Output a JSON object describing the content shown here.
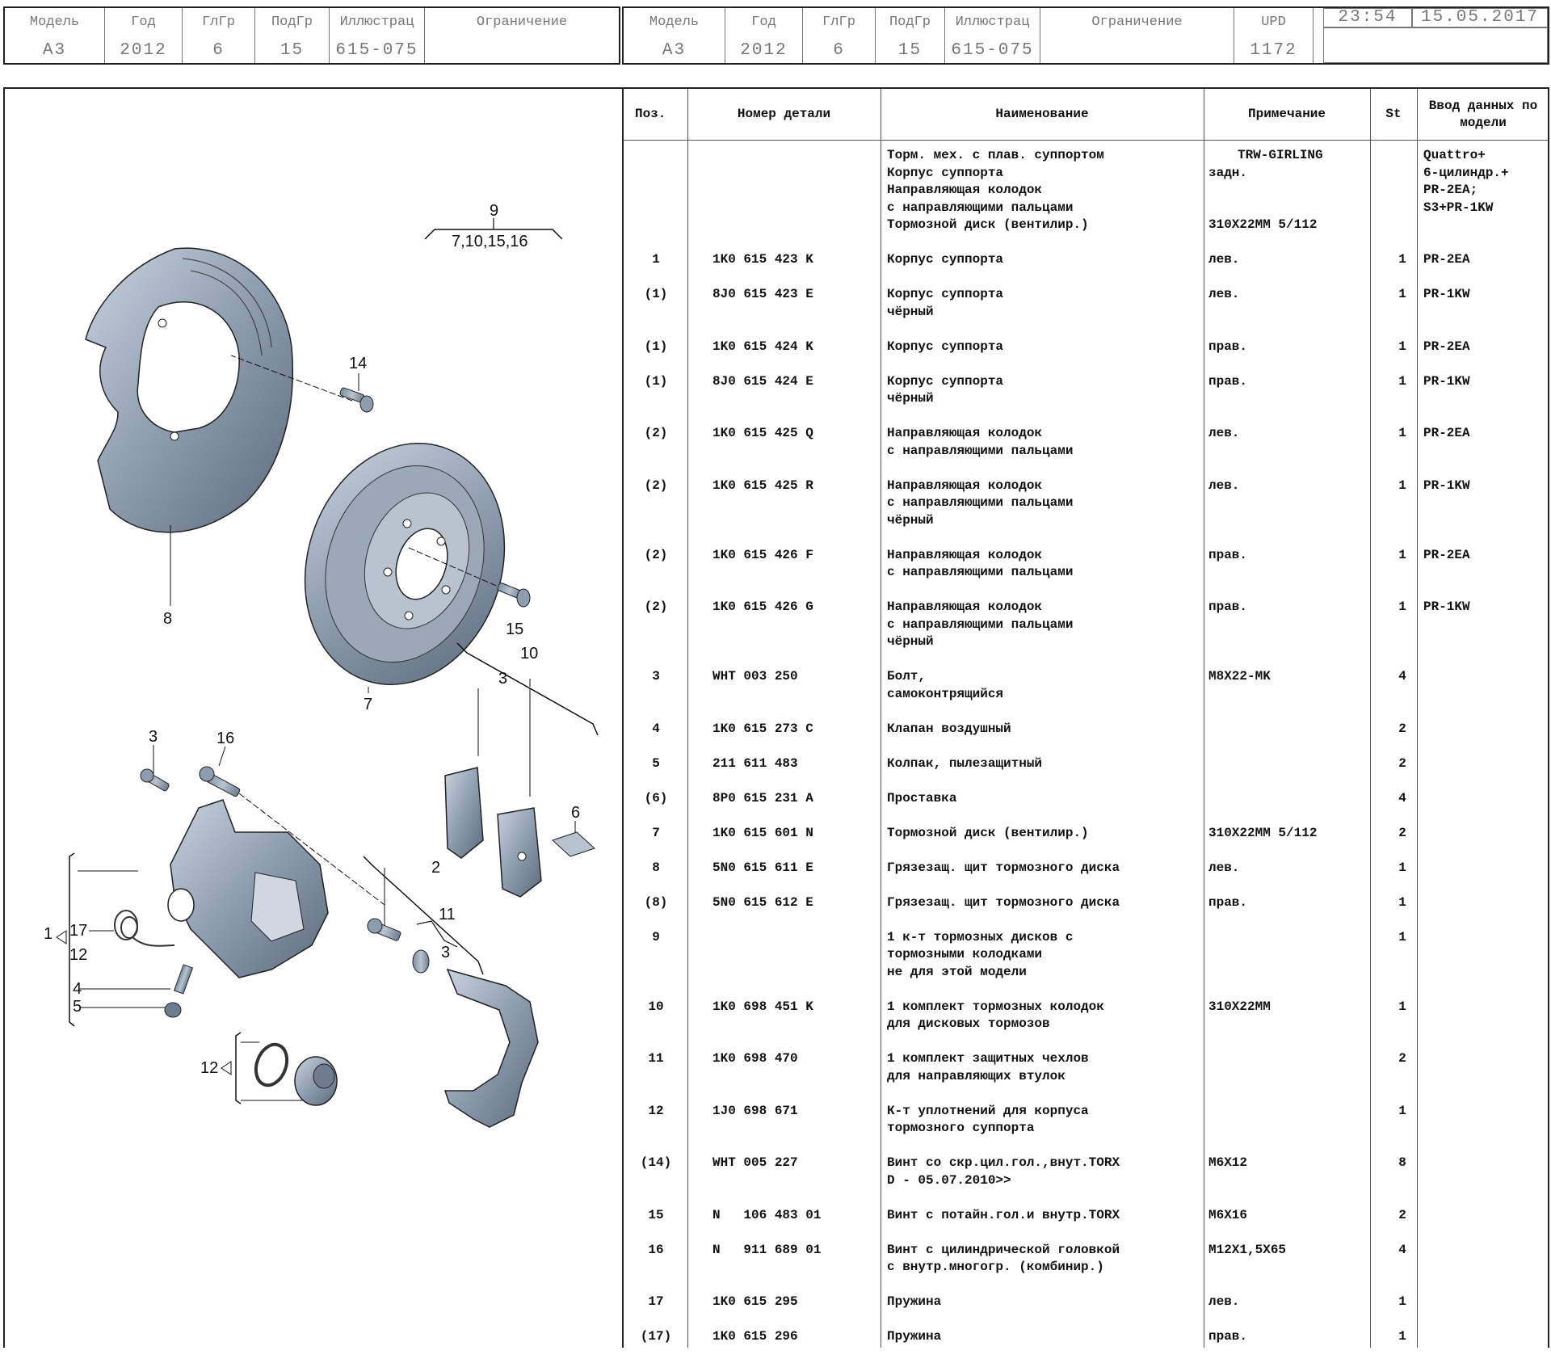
{
  "header_left": {
    "labels": [
      "Модель",
      "Год",
      "ГлГр",
      "ПодГр",
      "Иллюстрац",
      "Ограничение"
    ],
    "values": [
      "A3",
      "2012",
      "6",
      "15",
      "615-075",
      ""
    ]
  },
  "header_right": {
    "labels": [
      "Модель",
      "Год",
      "ГлГр",
      "ПодГр",
      "Иллюстрац",
      "Ограничение",
      "UPD"
    ],
    "values": [
      "A3",
      "2012",
      "6",
      "15",
      "615-075",
      "",
      "1172"
    ],
    "time": "23:54",
    "date": "15.05.2017"
  },
  "table_headers": {
    "pos": "Поз.",
    "part": "Номер детали",
    "name": "Наименование",
    "note": "Примечание",
    "st": "St",
    "data": "Ввод данных по модели"
  },
  "intro": {
    "name": [
      "Торм. мех. с плав. суппортом",
      "Корпус суппорта",
      "Направляющая колодок",
      "с направляющими пальцами",
      "Тормозной диск (вентилир.)"
    ],
    "note": [
      "TRW-GIRLING",
      "задн.",
      "",
      "",
      "310X22MM 5/112"
    ],
    "data": [
      "Quattro+",
      "6-цилиндр.+",
      "PR-2EA;",
      "S3+PR-1KW"
    ]
  },
  "rows": [
    {
      "pos": "1",
      "part": "1K0 615 423 K",
      "name": [
        "Корпус суппорта"
      ],
      "note": "лев.",
      "st": "1",
      "data": "PR-2EA"
    },
    {
      "pos": "(1)",
      "part": "8J0 615 423 E",
      "name": [
        "Корпус суппорта",
        "чёрный"
      ],
      "note": "лев.",
      "st": "1",
      "data": "PR-1KW"
    },
    {
      "pos": "(1)",
      "part": "1K0 615 424 K",
      "name": [
        "Корпус суппорта"
      ],
      "note": "прав.",
      "st": "1",
      "data": "PR-2EA"
    },
    {
      "pos": "(1)",
      "part": "8J0 615 424 E",
      "name": [
        "Корпус суппорта",
        "чёрный"
      ],
      "note": "прав.",
      "st": "1",
      "data": "PR-1KW"
    },
    {
      "pos": "(2)",
      "part": "1K0 615 425 Q",
      "name": [
        "Направляющая колодок",
        "с направляющими пальцами"
      ],
      "note": "лев.",
      "st": "1",
      "data": "PR-2EA"
    },
    {
      "pos": "(2)",
      "part": "1K0 615 425 R",
      "name": [
        "Направляющая колодок",
        "с направляющими пальцами",
        "чёрный"
      ],
      "note": "лев.",
      "st": "1",
      "data": "PR-1KW"
    },
    {
      "pos": "(2)",
      "part": "1K0 615 426 F",
      "name": [
        "Направляющая колодок",
        "с направляющими пальцами"
      ],
      "note": "прав.",
      "st": "1",
      "data": "PR-2EA"
    },
    {
      "pos": "(2)",
      "part": "1K0 615 426 G",
      "name": [
        "Направляющая колодок",
        "с направляющими пальцами",
        "чёрный"
      ],
      "note": "прав.",
      "st": "1",
      "data": "PR-1KW"
    },
    {
      "pos": "3",
      "part": "WHT 003 250",
      "name": [
        "Болт,",
        "самоконтрящийся"
      ],
      "note": "M8X22-MK",
      "st": "4",
      "data": ""
    },
    {
      "pos": "4",
      "part": "1K0 615 273 C",
      "name": [
        "Клапан воздушный"
      ],
      "note": "",
      "st": "2",
      "data": ""
    },
    {
      "pos": "5",
      "part": "211 611 483",
      "name": [
        "Колпак, пылезащитный"
      ],
      "note": "",
      "st": "2",
      "data": ""
    },
    {
      "pos": "(6)",
      "part": "8P0 615 231 A",
      "name": [
        "Проставка"
      ],
      "note": "",
      "st": "4",
      "data": ""
    },
    {
      "pos": "7",
      "part": "1K0 615 601 N",
      "name": [
        "Тормозной диск (вентилир.)"
      ],
      "note": "310X22MM 5/112",
      "st": "2",
      "data": ""
    },
    {
      "pos": "8",
      "part": "5N0 615 611 E",
      "name": [
        "Грязезащ. щит тормозного диска"
      ],
      "note": "лев.",
      "st": "1",
      "data": ""
    },
    {
      "pos": "(8)",
      "part": "5N0 615 612 E",
      "name": [
        "Грязезащ. щит тормозного диска"
      ],
      "note": "прав.",
      "st": "1",
      "data": ""
    },
    {
      "pos": "9",
      "part": "",
      "name": [
        "1 к-т тормозных дисков с",
        "тормозными колодками",
        "не для этой модели"
      ],
      "note": "",
      "st": "1",
      "data": ""
    },
    {
      "pos": "10",
      "part": "1K0 698 451 K",
      "name": [
        "1 комплект тормозных колодок",
        "для дисковых тормозов"
      ],
      "note": "310X22MM",
      "st": "1",
      "data": ""
    },
    {
      "pos": "11",
      "part": "1K0 698 470",
      "name": [
        "1 комплект защитных чехлов",
        "для направляющих втулок"
      ],
      "note": "",
      "st": "2",
      "data": ""
    },
    {
      "pos": "12",
      "part": "1J0 698 671",
      "name": [
        "К-т уплотнений для корпуса",
        "тормозного суппорта"
      ],
      "note": "",
      "st": "1",
      "data": ""
    },
    {
      "pos": "(14)",
      "part": "WHT 005 227",
      "name": [
        "Винт со скр.цил.гол.,внут.TORX",
        "D - 05.07.2010>>"
      ],
      "note": "M6X12",
      "st": "8",
      "data": ""
    },
    {
      "pos": "15",
      "part": "N   106 483 01",
      "name": [
        "Винт с потайн.гол.и внутр.TORX"
      ],
      "note": "M6X16",
      "st": "2",
      "data": ""
    },
    {
      "pos": "16",
      "part": "N   911 689 01",
      "name": [
        "Винт с цилиндрической головкой",
        "с внутр.многогр. (комбинир.)"
      ],
      "note": "M12X1,5X65",
      "st": "4",
      "data": ""
    },
    {
      "pos": "17",
      "part": "1K0 615 295",
      "name": [
        "Пружина"
      ],
      "note": "лев.",
      "st": "1",
      "data": ""
    },
    {
      "pos": "(17)",
      "part": "1K0 615 296",
      "name": [
        "Пружина"
      ],
      "note": "прав.",
      "st": "1",
      "data": ""
    }
  ],
  "diagram_callouts": {
    "c9": "9",
    "c9sub": "7,10,15,16",
    "c14": "14",
    "c8": "8",
    "c15": "15",
    "c7": "7",
    "c3a": "3",
    "c16": "16",
    "c10": "10",
    "c3b": "3",
    "c6": "6",
    "c2": "2",
    "c11": "11",
    "c3c": "3",
    "c1": "1",
    "c17": "17",
    "c12a": "12",
    "c4": "4",
    "c5": "5",
    "c12b": "12"
  }
}
